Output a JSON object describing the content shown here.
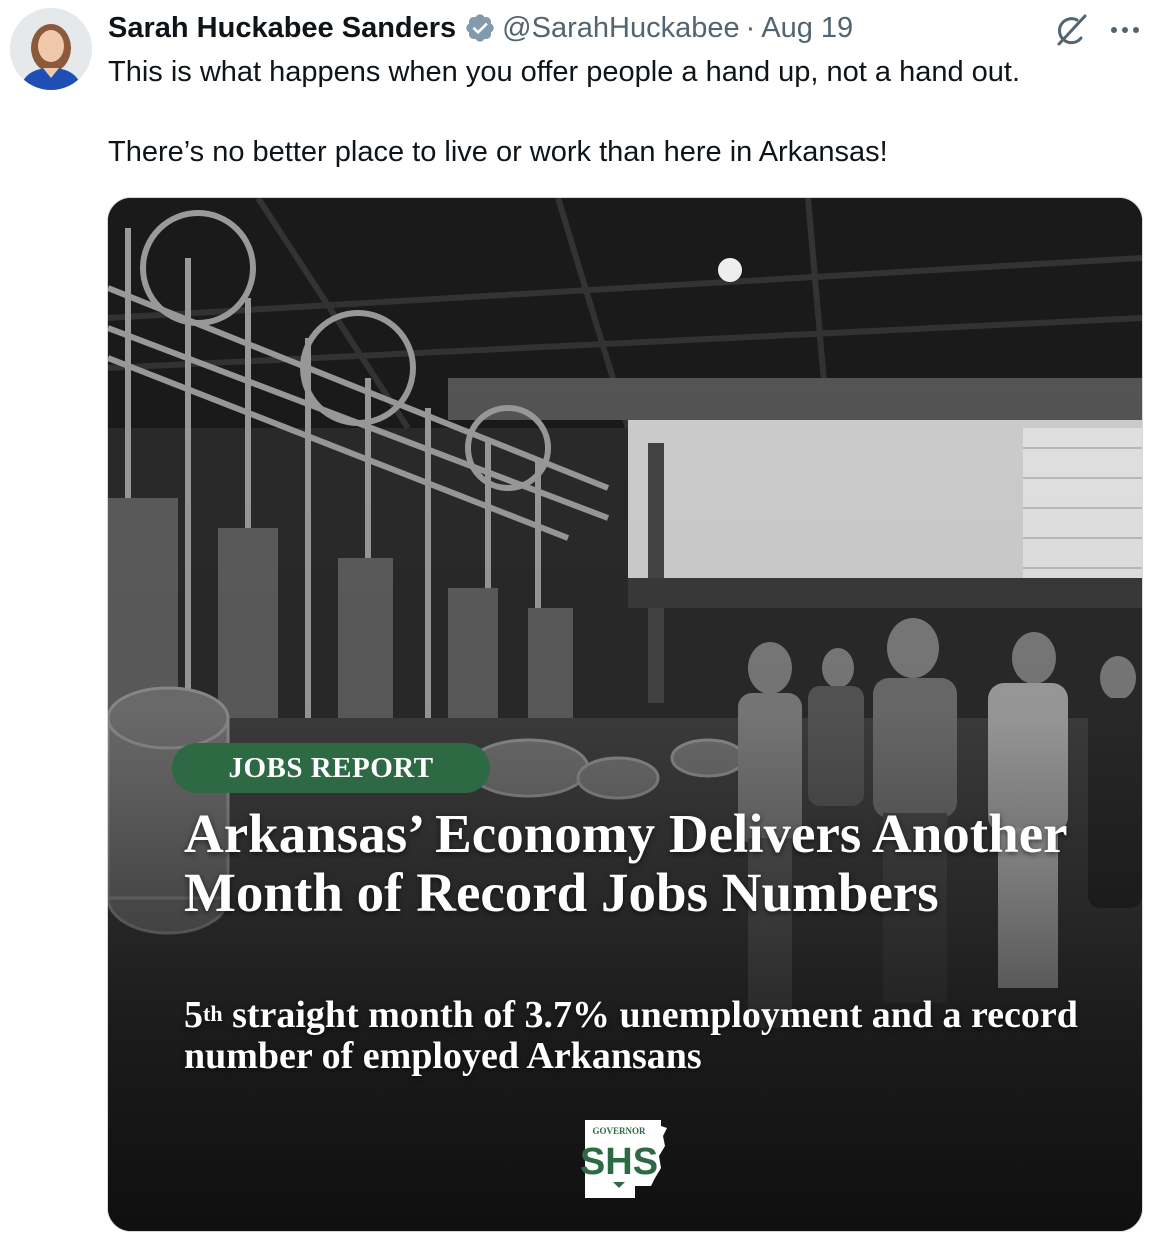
{
  "tweet": {
    "author_name": "Sarah Huckabee Sanders",
    "handle": "@SarahHuckabee",
    "separator": "·",
    "date": "Aug 19",
    "text": "This is what happens when you offer people a hand up, not a hand out.\n\nThere’s no better place to live or work than here in Arkansas!",
    "icons": {
      "avatar": "profile-photo",
      "verified": "verified-badge-icon",
      "grok": "grok-icon",
      "more": "more-icon"
    },
    "colors": {
      "verified_gray": "#829aab",
      "muted_text": "#536471"
    }
  },
  "media": {
    "pill_label": "JOBS REPORT",
    "headline": "Arkansas’ Economy Delivers Another Month of Record Jobs Numbers",
    "sub_sup": "th",
    "sub_num": "5",
    "sub_rest": " straight month of 3.7% unemployment and a record number of employed Arkansans",
    "logo_top": "GOVERNOR",
    "logo_main": "SHS",
    "colors": {
      "pill": "#2d6a44"
    }
  }
}
